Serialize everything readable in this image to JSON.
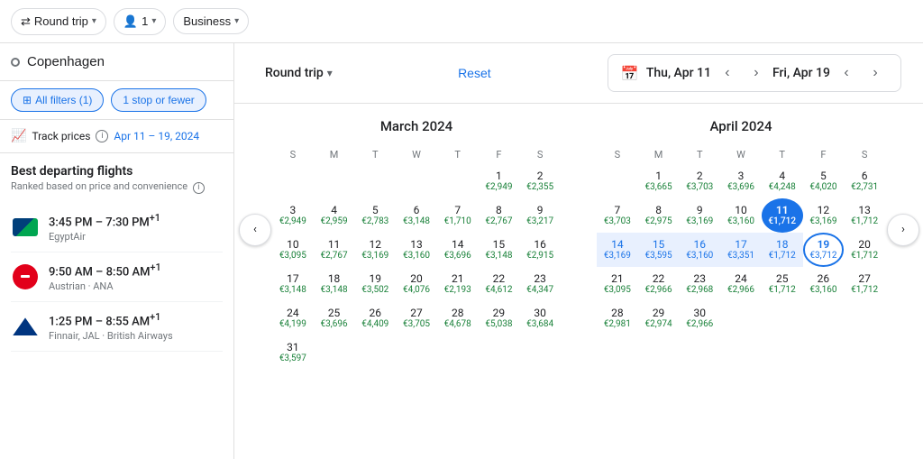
{
  "topBar": {
    "roundTrip": "Round trip",
    "passengers": "1",
    "class": "Business"
  },
  "leftPanel": {
    "searchPlaceholder": "Copenhagen",
    "filters": {
      "allFilters": "All filters (1)",
      "stopFilter": "1 stop or fewer"
    },
    "trackPrices": {
      "label": "Track prices",
      "dateRange": "Apr 11 – 19, 2024"
    },
    "bestFlights": {
      "title": "Best departing flights",
      "subtitle": "Ranked based on price and convenience"
    },
    "flights": [
      {
        "time": "3:45 PM – 7:30 PM",
        "suffix": "+1",
        "airline": "EgyptAir",
        "logo": "egyptair"
      },
      {
        "time": "9:50 AM – 8:50 AM",
        "suffix": "+1",
        "airline": "Austrian · ANA",
        "logo": "austrian"
      },
      {
        "time": "1:25 PM – 8:55 AM",
        "suffix": "+1",
        "airline": "Finnair, JAL · British Airways",
        "logo": "finnair"
      }
    ]
  },
  "calendarHeader": {
    "roundTrip": "Round trip",
    "reset": "Reset",
    "startDate": "Thu, Apr 11",
    "endDate": "Fri, Apr 19"
  },
  "march2024": {
    "title": "March 2024",
    "days": [
      "S",
      "M",
      "T",
      "W",
      "T",
      "F",
      "S"
    ],
    "cells": [
      {
        "day": "",
        "price": ""
      },
      {
        "day": "",
        "price": ""
      },
      {
        "day": "",
        "price": ""
      },
      {
        "day": "",
        "price": ""
      },
      {
        "day": "",
        "price": ""
      },
      {
        "day": "1",
        "price": "€2,949"
      },
      {
        "day": "2",
        "price": "€2,355"
      },
      {
        "day": "3",
        "price": "€2,949"
      },
      {
        "day": "4",
        "price": "€2,959"
      },
      {
        "day": "5",
        "price": "€2,783"
      },
      {
        "day": "6",
        "price": "€3,148"
      },
      {
        "day": "7",
        "price": "€1,710",
        "low": true
      },
      {
        "day": "8",
        "price": "€2,767"
      },
      {
        "day": "9",
        "price": "€3,217"
      },
      {
        "day": "10",
        "price": "€3,095"
      },
      {
        "day": "11",
        "price": "€2,767"
      },
      {
        "day": "12",
        "price": "€3,169"
      },
      {
        "day": "13",
        "price": "€3,160"
      },
      {
        "day": "14",
        "price": "€3,696"
      },
      {
        "day": "15",
        "price": "€3,148"
      },
      {
        "day": "16",
        "price": "€2,915"
      },
      {
        "day": "17",
        "price": "€3,148"
      },
      {
        "day": "18",
        "price": "€3,148"
      },
      {
        "day": "19",
        "price": "€3,502"
      },
      {
        "day": "20",
        "price": "€4,076"
      },
      {
        "day": "21",
        "price": "€2,193"
      },
      {
        "day": "22",
        "price": "€4,612"
      },
      {
        "day": "23",
        "price": "€4,347"
      },
      {
        "day": "24",
        "price": "€4,199"
      },
      {
        "day": "25",
        "price": "€3,696"
      },
      {
        "day": "26",
        "price": "€4,409"
      },
      {
        "day": "27",
        "price": "€3,705"
      },
      {
        "day": "28",
        "price": "€4,678"
      },
      {
        "day": "29",
        "price": "€5,038"
      },
      {
        "day": "30",
        "price": "€3,684"
      },
      {
        "day": "31",
        "price": "€3,597"
      },
      {
        "day": "",
        "price": ""
      },
      {
        "day": "",
        "price": ""
      },
      {
        "day": "",
        "price": ""
      },
      {
        "day": "",
        "price": ""
      },
      {
        "day": "",
        "price": ""
      },
      {
        "day": "",
        "price": ""
      }
    ]
  },
  "april2024": {
    "title": "April 2024",
    "days": [
      "S",
      "M",
      "T",
      "W",
      "T",
      "F",
      "S"
    ],
    "cells": [
      {
        "day": "",
        "price": ""
      },
      {
        "day": "1",
        "price": "€3,665"
      },
      {
        "day": "2",
        "price": "€3,703"
      },
      {
        "day": "3",
        "price": "€3,696"
      },
      {
        "day": "4",
        "price": "€4,248"
      },
      {
        "day": "5",
        "price": "€4,020"
      },
      {
        "day": "6",
        "price": "€2,731"
      },
      {
        "day": "7",
        "price": "€3,703"
      },
      {
        "day": "8",
        "price": "€2,975"
      },
      {
        "day": "9",
        "price": "€3,169"
      },
      {
        "day": "10",
        "price": "€3,160"
      },
      {
        "day": "11",
        "price": "€1,712",
        "selected": "start",
        "low": true
      },
      {
        "day": "12",
        "price": "€3,169"
      },
      {
        "day": "13",
        "price": "€1,712",
        "low": true
      },
      {
        "day": "14",
        "price": "€3,169",
        "inRange": true
      },
      {
        "day": "15",
        "price": "€3,595",
        "inRange": true
      },
      {
        "day": "16",
        "price": "€3,160",
        "inRange": true
      },
      {
        "day": "17",
        "price": "€3,351",
        "inRange": true
      },
      {
        "day": "18",
        "price": "€1,712",
        "inRange": true,
        "low": true
      },
      {
        "day": "19",
        "price": "€3,712",
        "selected": "end"
      },
      {
        "day": "20",
        "price": "€1,712",
        "low": true
      },
      {
        "day": "21",
        "price": "€3,095"
      },
      {
        "day": "22",
        "price": "€2,966"
      },
      {
        "day": "23",
        "price": "€2,968"
      },
      {
        "day": "24",
        "price": "€2,966"
      },
      {
        "day": "25",
        "price": "€1,712",
        "low": true
      },
      {
        "day": "26",
        "price": "€3,160"
      },
      {
        "day": "27",
        "price": "€1,712",
        "low": true
      },
      {
        "day": "28",
        "price": "€2,981"
      },
      {
        "day": "29",
        "price": "€2,974"
      },
      {
        "day": "30",
        "price": "€2,966"
      },
      {
        "day": "",
        "price": ""
      },
      {
        "day": "",
        "price": ""
      },
      {
        "day": "",
        "price": ""
      },
      {
        "day": "",
        "price": ""
      }
    ]
  }
}
